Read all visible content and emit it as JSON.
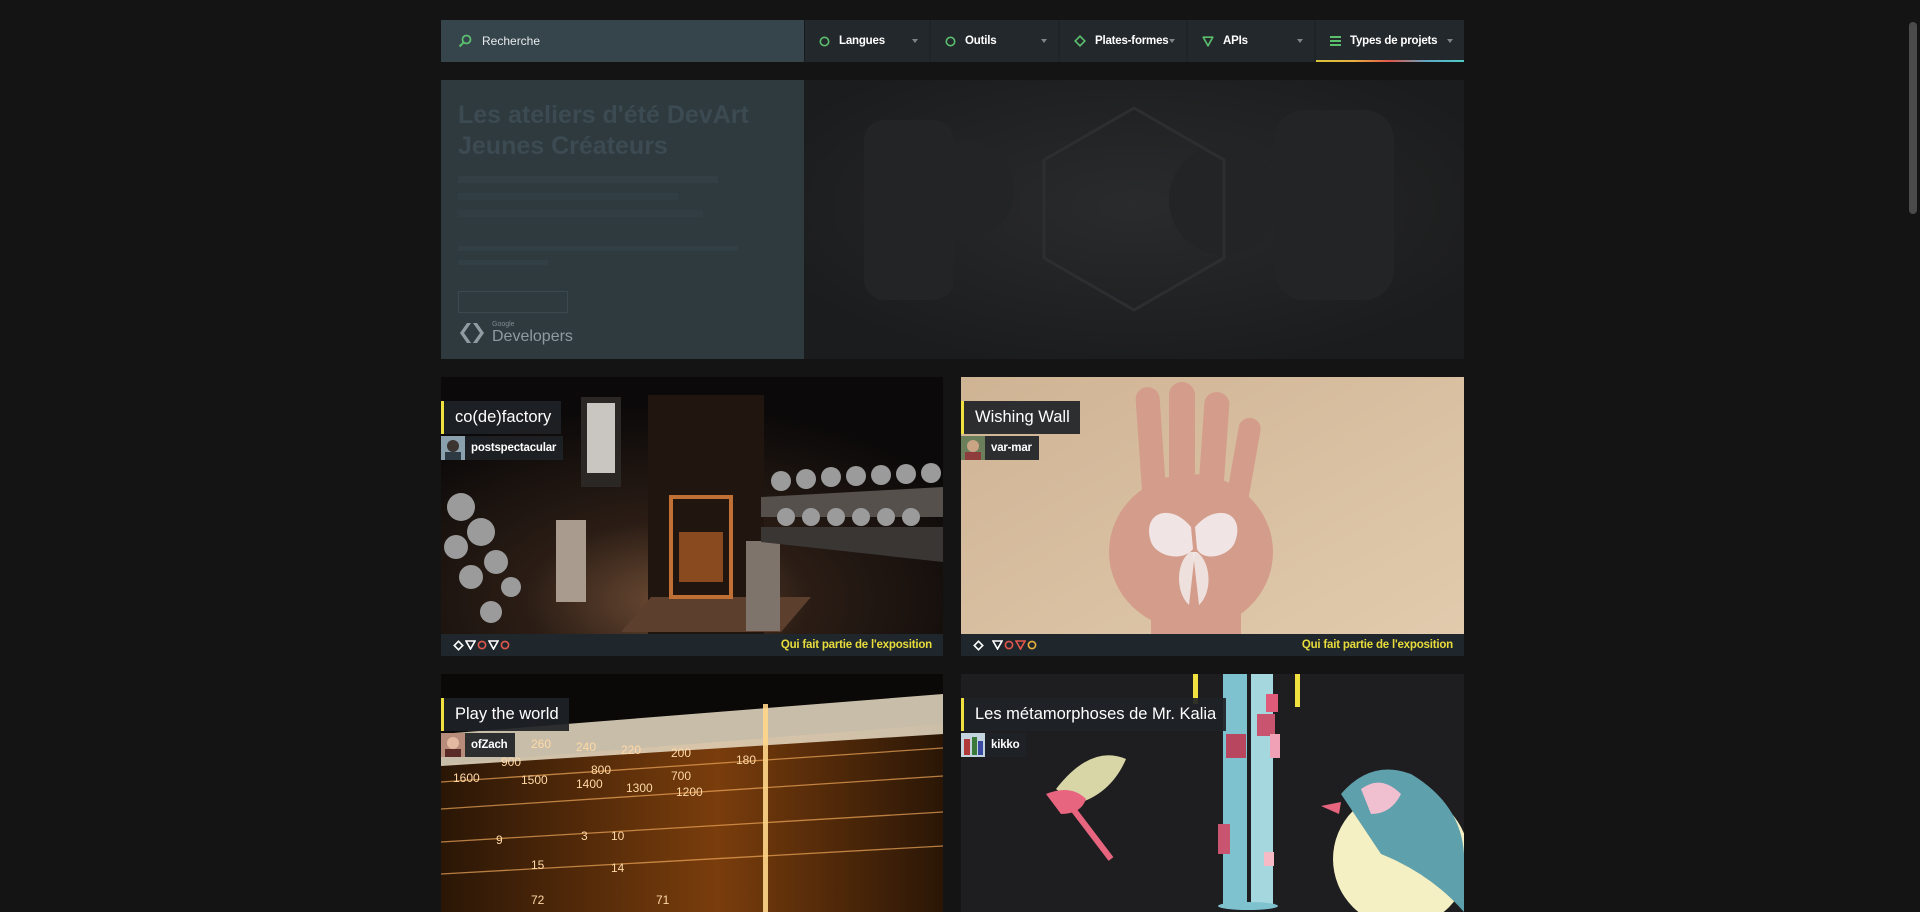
{
  "search": {
    "placeholder": "Recherche"
  },
  "filters": [
    {
      "label": "Langues",
      "icon": "circle-icon",
      "color": "#5bbf6e"
    },
    {
      "label": "Outils",
      "icon": "circle-icon",
      "color": "#5bbf6e"
    },
    {
      "label": "Plates-formes",
      "icon": "diamond-icon",
      "color": "#5bbf6e"
    },
    {
      "label": "APIs",
      "icon": "triangle-icon",
      "color": "#5bbf6e"
    },
    {
      "label": "Types de projets",
      "icon": "list-icon",
      "color": "#5bbf6e"
    }
  ],
  "banner": {
    "title": "Les ateliers d'été DevArt Jeunes Créateurs",
    "description": "",
    "logo_small": "Google",
    "logo_big": "Developers"
  },
  "projects": [
    {
      "title": "co(de)factory",
      "author": "postspectacular",
      "footer": "Qui fait partie de l'exposition"
    },
    {
      "title": "Wishing Wall",
      "author": "var-mar",
      "footer": "Qui fait partie de l'exposition"
    },
    {
      "title": "Play the world",
      "author": "ofZach"
    },
    {
      "title": "Les métamorphoses de Mr. Kalia",
      "author": "kikko"
    }
  ],
  "colors": {
    "accent_yellow": "#f0e040",
    "accent_green": "#5bbf6e",
    "background": "#141414"
  }
}
